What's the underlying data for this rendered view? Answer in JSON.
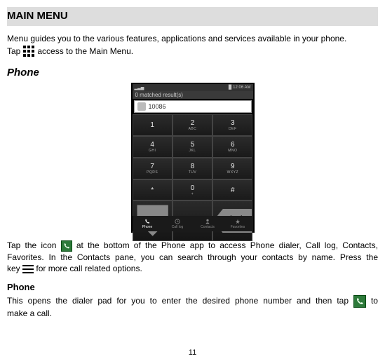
{
  "title": "MAIN MENU",
  "intro_line1": "Menu guides you to the various features, applications and services available in your phone.",
  "intro_line2_a": "Tap",
  "intro_line2_b": "access to the Main Menu.",
  "section_phone": "Phone",
  "screenshot": {
    "status_signal": "▂▃▅",
    "status_batt": "█",
    "status_time": "12:06 AM",
    "matched": "0 matched result(s)",
    "number": "10086",
    "keys": [
      {
        "n": "1",
        "s": ""
      },
      {
        "n": "2",
        "s": "ABC"
      },
      {
        "n": "3",
        "s": "DEF"
      },
      {
        "n": "4",
        "s": "GHI"
      },
      {
        "n": "5",
        "s": "JKL"
      },
      {
        "n": "6",
        "s": "MNO"
      },
      {
        "n": "7",
        "s": "PQRS"
      },
      {
        "n": "8",
        "s": "TUV"
      },
      {
        "n": "9",
        "s": "WXYZ"
      },
      {
        "n": "*",
        "s": ""
      },
      {
        "n": "0",
        "s": "+"
      },
      {
        "n": "#",
        "s": ""
      }
    ],
    "tabs": [
      "Phone",
      "Call log",
      "Contacts",
      "Favorites"
    ]
  },
  "para2_a": "Tap the icon",
  "para2_b": "at the bottom of the Phone app to access Phone dialer, Call log, Contacts,",
  "para2_c": "Favorites. In the Contacts pane, you can search through your contacts by name. Press the",
  "para2_d1": "key",
  "para2_d2": "for more call related options.",
  "subhead_phone": "Phone",
  "para3_a": "This opens the dialer pad for you to enter the desired phone number and then tap",
  "para3_b": "to",
  "para3_c": "make a call.",
  "page_number": "11"
}
